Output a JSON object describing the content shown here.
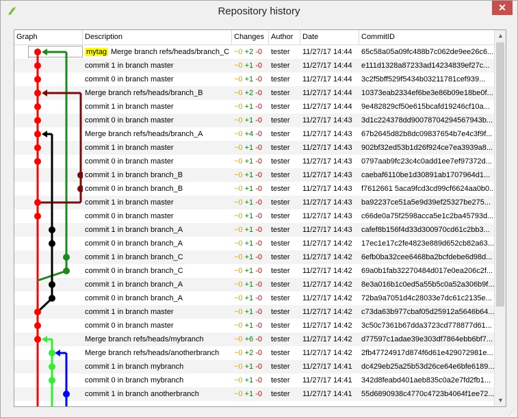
{
  "window": {
    "title": "Repository history",
    "close_glyph": "✕"
  },
  "columns": [
    "Graph",
    "Description",
    "Changes",
    "Author",
    "Date",
    "CommitID"
  ],
  "rows": [
    {
      "tag": "mytag",
      "desc": "Merge branch refs/heads/branch_C",
      "mod": "~0",
      "add": "+2",
      "del": "-0",
      "author": "tester",
      "date": "11/27/17 14:44",
      "id": "65c58a05a09fc488b7c062de9ee26c6..."
    },
    {
      "desc": "commit 1 in branch master",
      "mod": "~0",
      "add": "+1",
      "del": "-0",
      "author": "tester",
      "date": "11/27/17 14:44",
      "id": "e111d1328a87233ad14234839ef27c..."
    },
    {
      "desc": "commit 0 in branch master",
      "mod": "~0",
      "add": "+1",
      "del": "-0",
      "author": "tester",
      "date": "11/27/17 14:44",
      "id": "3c2f5bff529f5434b03211781cef939..."
    },
    {
      "desc": "Merge branch refs/heads/branch_B",
      "mod": "~0",
      "add": "+2",
      "del": "-0",
      "author": "tester",
      "date": "11/27/17 14:44",
      "id": "10373eab2334ef6be3e86b09e18be0f..."
    },
    {
      "desc": "commit 1 in branch master",
      "mod": "~0",
      "add": "+1",
      "del": "-0",
      "author": "tester",
      "date": "11/27/17 14:44",
      "id": "9e482829cf50e615bcafd19246cf10a..."
    },
    {
      "desc": "commit 0 in branch master",
      "mod": "~0",
      "add": "+1",
      "del": "-0",
      "author": "tester",
      "date": "11/27/17 14:43",
      "id": "3d1c224378dd90078704294567943b..."
    },
    {
      "desc": "Merge branch refs/heads/branch_A",
      "mod": "~0",
      "add": "+4",
      "del": "-0",
      "author": "tester",
      "date": "11/27/17 14:43",
      "id": "67b2645d82b8dc09837654b7e4c3f9f..."
    },
    {
      "desc": "commit 1 in branch master",
      "mod": "~0",
      "add": "+1",
      "del": "-0",
      "author": "tester",
      "date": "11/27/17 14:43",
      "id": "902bf32ed53b1d26f924ce7ea3939a8..."
    },
    {
      "desc": "commit 0 in branch master",
      "mod": "~0",
      "add": "+1",
      "del": "-0",
      "author": "tester",
      "date": "11/27/17 14:43",
      "id": "0797aab9fc23c4c0add1ee7ef97372d..."
    },
    {
      "desc": "commit 1 in branch branch_B",
      "mod": "~0",
      "add": "+1",
      "del": "-0",
      "author": "tester",
      "date": "11/27/17 14:43",
      "id": "caebaf6110be1d30891ab1707964d1..."
    },
    {
      "desc": "commit 0 in branch branch_B",
      "mod": "~0",
      "add": "+1",
      "del": "-0",
      "author": "tester",
      "date": "11/27/17 14:43",
      "id": "f7612661 5aca9fcd3cd99cf6624aa0b0..."
    },
    {
      "desc": "commit 1 in branch master",
      "mod": "~0",
      "add": "+1",
      "del": "-0",
      "author": "tester",
      "date": "11/27/17 14:43",
      "id": "ba92237ce51a5e9d39ef25327be275..."
    },
    {
      "desc": "commit 0 in branch master",
      "mod": "~0",
      "add": "+1",
      "del": "-0",
      "author": "tester",
      "date": "11/27/17 14:43",
      "id": "c66de0a75f2598acca5e1c2ba45793d..."
    },
    {
      "desc": "commit 1 in branch branch_A",
      "mod": "~0",
      "add": "+1",
      "del": "-0",
      "author": "tester",
      "date": "11/27/17 14:43",
      "id": "cafef8b156f4d33d300970cd61c2bb3..."
    },
    {
      "desc": "commit 0 in branch branch_A",
      "mod": "~0",
      "add": "+1",
      "del": "-0",
      "author": "tester",
      "date": "11/27/17 14:42",
      "id": "17ec1e17c2fe4823e889d652cb82a63..."
    },
    {
      "desc": "commit 1 in branch branch_C",
      "mod": "~0",
      "add": "+1",
      "del": "-0",
      "author": "tester",
      "date": "11/27/17 14:42",
      "id": "6efb0ba32cee6468ba2bcfdebe6d98d..."
    },
    {
      "desc": "commit 0 in branch branch_C",
      "mod": "~0",
      "add": "+1",
      "del": "-0",
      "author": "tester",
      "date": "11/27/17 14:42",
      "id": "69a0b1fab32270484d017e0ea206c2f..."
    },
    {
      "desc": "commit 1 in branch branch_A",
      "mod": "~0",
      "add": "+1",
      "del": "-0",
      "author": "tester",
      "date": "11/27/17 14:42",
      "id": "8e3a016b1c0ed5a55b5c0a52a306b9f..."
    },
    {
      "desc": "commit 0 in branch branch_A",
      "mod": "~0",
      "add": "+1",
      "del": "-0",
      "author": "tester",
      "date": "11/27/17 14:42",
      "id": "72ba9a7051d4c28033e7dc61c2135e..."
    },
    {
      "desc": "commit 1 in branch master",
      "mod": "~0",
      "add": "+1",
      "del": "-0",
      "author": "tester",
      "date": "11/27/17 14:42",
      "id": "c73da63b977cbaf05d25912a5646b64..."
    },
    {
      "desc": "commit 0 in branch master",
      "mod": "~0",
      "add": "+1",
      "del": "-0",
      "author": "tester",
      "date": "11/27/17 14:42",
      "id": "3c50c7361b67dda3723cd778877d61..."
    },
    {
      "desc": "Merge branch refs/heads/mybranch",
      "mod": "~0",
      "add": "+6",
      "del": "-0",
      "author": "tester",
      "date": "11/27/17 14:42",
      "id": "d77597c1adae39e303df7864ebb6bf7..."
    },
    {
      "desc": "Merge branch refs/heads/anotherbranch",
      "mod": "~0",
      "add": "+2",
      "del": "-0",
      "author": "tester",
      "date": "11/27/17 14:42",
      "id": "2fb47724917d874f6d61e429072981e..."
    },
    {
      "desc": "commit 1 in branch mybranch",
      "mod": "~0",
      "add": "+1",
      "del": "-0",
      "author": "tester",
      "date": "11/27/17 14:41",
      "id": "dc429eb25a25b53d26ce64e6bfe6189..."
    },
    {
      "desc": "commit 0 in branch mybranch",
      "mod": "~0",
      "add": "+1",
      "del": "-0",
      "author": "tester",
      "date": "11/27/17 14:41",
      "id": "342d8feabd401aeb835c0a2e7fd2fb1..."
    },
    {
      "desc": "commit 1 in branch anotherbranch",
      "mod": "~0",
      "add": "+1",
      "del": "-0",
      "author": "tester",
      "date": "11/27/17 14:41",
      "id": "55d6890938c4770c4723b4064f1ee72..."
    }
  ],
  "colors": {
    "master": "#ff0000",
    "branch_C": "#1a8a1a",
    "branch_B": "#7a0a0a",
    "branch_A": "#000000",
    "mybranch": "#33ee33",
    "anotherbranch": "#0000ff"
  }
}
